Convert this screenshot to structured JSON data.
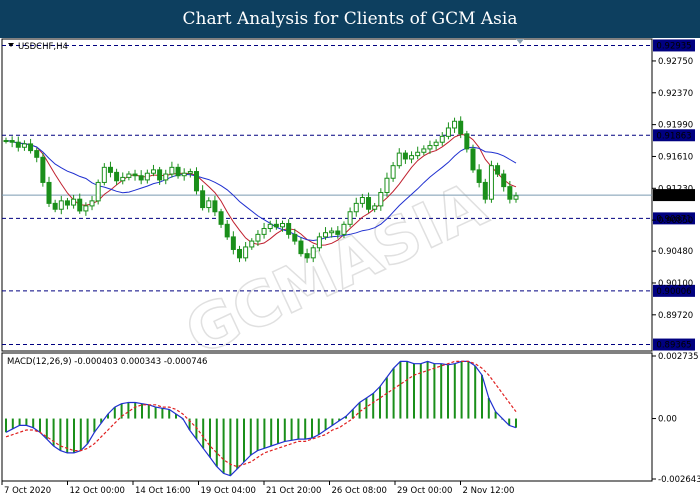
{
  "header": {
    "title": "Chart Analysis for Clients of GCM Asia"
  },
  "chart_data": [
    {
      "type": "candlestick",
      "symbol_label": "USDCHF,H4",
      "ylim": [
        0.893,
        0.93
      ],
      "y_ticks": [
        "0.92935",
        "0.92750",
        "0.92370",
        "0.91990",
        "0.91610",
        "0.91230",
        "0.90850",
        "0.90480",
        "0.90100",
        "0.89720",
        "0.89365"
      ],
      "hlines": [
        {
          "value": 0.92935,
          "label": "0.92935"
        },
        {
          "value": 0.91863,
          "label": "0.91863"
        },
        {
          "value": 0.90871,
          "label": "0.90871"
        },
        {
          "value": 0.90006,
          "label": "0.90006"
        },
        {
          "value": 0.89365,
          "label": "0.89365"
        }
      ],
      "current_price": {
        "value": 0.91149,
        "label": "0.91149"
      },
      "watermark": "GCMASIA",
      "x_labels": [
        "7 Oct 2020",
        "12 Oct 00:00",
        "14 Oct 16:00",
        "19 Oct 04:00",
        "21 Oct 20:00",
        "26 Oct 08:00",
        "29 Oct 00:00",
        "2 Nov 12:00"
      ],
      "closes": [
        0.918,
        0.9178,
        0.9172,
        0.9176,
        0.9168,
        0.916,
        0.913,
        0.9105,
        0.9098,
        0.9108,
        0.9103,
        0.911,
        0.9096,
        0.9102,
        0.9108,
        0.913,
        0.9148,
        0.9142,
        0.9132,
        0.9136,
        0.914,
        0.9138,
        0.9133,
        0.9141,
        0.9145,
        0.9133,
        0.914,
        0.9148,
        0.9138,
        0.9141,
        0.9143,
        0.912,
        0.91,
        0.9108,
        0.9095,
        0.908,
        0.9065,
        0.905,
        0.904,
        0.9053,
        0.906,
        0.9068,
        0.9075,
        0.908,
        0.9077,
        0.9081,
        0.9068,
        0.906,
        0.9045,
        0.904,
        0.9052,
        0.9065,
        0.907,
        0.9072,
        0.9068,
        0.908,
        0.9095,
        0.9105,
        0.9112,
        0.9098,
        0.9102,
        0.9118,
        0.9135,
        0.915,
        0.9165,
        0.9158,
        0.9162,
        0.9166,
        0.917,
        0.9174,
        0.9178,
        0.9185,
        0.9195,
        0.9203,
        0.9188,
        0.917,
        0.9145,
        0.913,
        0.911,
        0.915,
        0.914,
        0.9125,
        0.911,
        0.9114
      ]
    },
    {
      "type": "macd",
      "label": "MACD(12,26,9) -0.000403 0.000343 -0.000746",
      "ylim": [
        -0.002643,
        0.002735
      ],
      "y_ticks": [
        "0.002735",
        "0.00",
        "-0.002643"
      ],
      "macd": [
        -0.0006,
        -0.00045,
        -0.0003,
        -0.0003,
        -0.0004,
        -0.0006,
        -0.0009,
        -0.0012,
        -0.0014,
        -0.0015,
        -0.0015,
        -0.0014,
        -0.0011,
        -0.0006,
        -0.0002,
        0.0002,
        0.0005,
        0.00065,
        0.0007,
        0.0007,
        0.00065,
        0.0006,
        0.0005,
        0.00045,
        0.0004,
        0.0002,
        0.0,
        -0.0005,
        -0.0009,
        -0.0013,
        -0.0017,
        -0.0021,
        -0.0024,
        -0.0025,
        -0.0022,
        -0.0019,
        -0.0016,
        -0.0014,
        -0.0013,
        -0.0012,
        -0.0011,
        -0.001,
        -0.00095,
        -0.0009,
        -0.0009,
        -0.00085,
        -0.0007,
        -0.0005,
        -0.0003,
        -0.0001,
        0.0001,
        0.0004,
        0.0007,
        0.0009,
        0.0011,
        0.0014,
        0.0018,
        0.0022,
        0.0025,
        0.0025,
        0.0024,
        0.0024,
        0.0025,
        0.0024,
        0.0024,
        0.00235,
        0.0024,
        0.0025,
        0.0025,
        0.0023,
        0.0019,
        0.0009,
        0.0003,
        0.0,
        -0.0003,
        -0.0004
      ],
      "signal": [
        -0.0008,
        -0.0007,
        -0.0006,
        -0.0005,
        -0.0005,
        -0.0006,
        -0.0008,
        -0.001,
        -0.0012,
        -0.0013,
        -0.0014,
        -0.0014,
        -0.0013,
        -0.0011,
        -0.0008,
        -0.0005,
        -0.0002,
        0.0001,
        0.0003,
        0.0005,
        0.0006,
        0.0006,
        0.0006,
        0.0005,
        0.0005,
        0.0004,
        0.0002,
        -0.0001,
        -0.0004,
        -0.0008,
        -0.0012,
        -0.0015,
        -0.0018,
        -0.002,
        -0.0021,
        -0.002,
        -0.0019,
        -0.0017,
        -0.0015,
        -0.0014,
        -0.0013,
        -0.0012,
        -0.0011,
        -0.001,
        -0.001,
        -0.0009,
        -0.0008,
        -0.0007,
        -0.0005,
        -0.0004,
        -0.0002,
        0.0,
        0.0003,
        0.0005,
        0.0007,
        0.0009,
        0.0011,
        0.0013,
        0.0015,
        0.0017,
        0.0019,
        0.002,
        0.0021,
        0.0022,
        0.0023,
        0.0024,
        0.0025,
        0.0025,
        0.0025,
        0.0024,
        0.0022,
        0.0019,
        0.0015,
        0.0011,
        0.0007,
        0.0003
      ]
    }
  ],
  "colors": {
    "header_bg": "#0d3f5f",
    "candle": "#1a8f1a",
    "ma_fast": "#c0202f",
    "ma_slow": "#2030d0",
    "levels": "#000080",
    "macd_hist": "#1a8f1a",
    "macd_line": "#2030d0",
    "signal_line": "#e02020",
    "current_price_line": "#7a9ab0"
  }
}
